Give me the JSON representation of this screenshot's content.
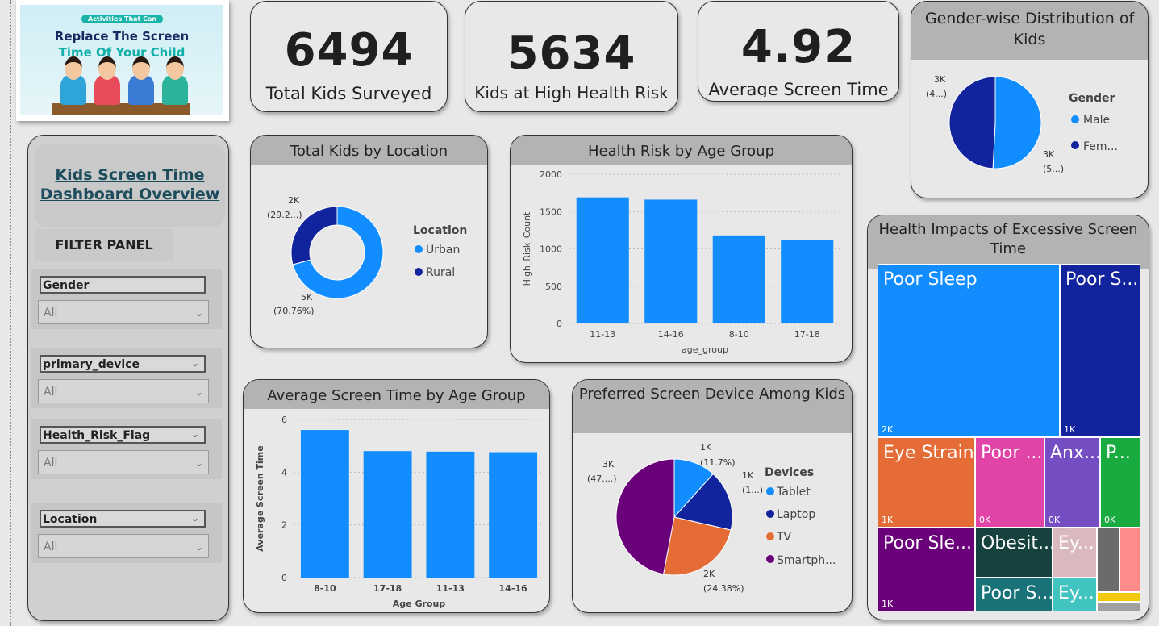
{
  "banner": {
    "tag": "Activities That Can",
    "line1": "Replace The Screen",
    "line2": "Time Of Your Child"
  },
  "kpis": [
    {
      "value": "6494",
      "label": "Total Kids Surveyed"
    },
    {
      "value": "5634",
      "label": "Kids at High Health Risk"
    },
    {
      "value": "4.92",
      "label": "Average Screen Time"
    }
  ],
  "sidebar": {
    "title_line1": "Kids Screen Time",
    "title_line2": "Dashboard Overview",
    "filter_panel": "FILTER PANEL",
    "slicers": [
      {
        "name": "Gender",
        "value": "All"
      },
      {
        "name": "primary_device",
        "value": "All"
      },
      {
        "name": "Health_Risk_Flag",
        "value": "All"
      },
      {
        "name": "Location",
        "value": "All"
      }
    ]
  },
  "colors": {
    "blue": "#118DFF",
    "navy": "#12239E",
    "orange": "#E66C37",
    "purple": "#6B007B",
    "pink": "#E044A7",
    "violet": "#744EC2",
    "green": "#1AAB40",
    "teal": "#15413E",
    "steel": "#197278"
  },
  "chart_data": [
    {
      "type": "pie",
      "title": "Gender-wise Distribution of Kids",
      "legend_title": "Gender",
      "legend_position": "right",
      "categories": [
        "Male",
        "Female"
      ],
      "legend_labels": [
        "Male",
        "Fem..."
      ],
      "data_labels": [
        [
          "3K",
          "(5...)"
        ],
        [
          "3K",
          "(4...)"
        ]
      ],
      "values": [
        3300,
        3194
      ]
    },
    {
      "type": "pie",
      "subtype": "donut",
      "title": "Total Kids by Location",
      "legend_title": "Location",
      "legend_position": "right",
      "categories": [
        "Urban",
        "Rural"
      ],
      "legend_labels": [
        "Urban",
        "Rural"
      ],
      "values": [
        70.76,
        29.24
      ],
      "data_labels": [
        [
          "5K",
          "(70.76%)"
        ],
        [
          "2K",
          "(29.2...)"
        ]
      ]
    },
    {
      "type": "bar",
      "title": "Health Risk by Age Group",
      "categories": [
        "11-13",
        "14-16",
        "8-10",
        "17-18"
      ],
      "values": [
        1690,
        1660,
        1180,
        1120
      ],
      "xlabel": "age_group",
      "ylabel": "High_Risk_Count",
      "ylim": [
        0,
        2000
      ],
      "yticks": [
        "0",
        "500",
        "1000",
        "1500",
        "2000"
      ],
      "grid": true
    },
    {
      "type": "bar",
      "title": "Average Screen Time by Age Group",
      "categories": [
        "8-10",
        "17-18",
        "11-13",
        "14-16"
      ],
      "values": [
        5.6,
        4.8,
        4.78,
        4.76
      ],
      "xlabel": "Age Group",
      "ylabel": "Average Screen Time",
      "ylim": [
        0,
        6
      ],
      "yticks": [
        "0",
        "2",
        "4",
        "6"
      ],
      "grid": true
    },
    {
      "type": "pie",
      "title": "Preferred Screen Device Among Kids",
      "legend_title": "Devices",
      "legend_position": "right",
      "categories": [
        "Tablet",
        "Laptop",
        "TV",
        "Smartphone"
      ],
      "legend_labels": [
        "Tablet",
        "Laptop",
        "TV",
        "Smartph..."
      ],
      "values": [
        11.7,
        16.9,
        24.38,
        47.02
      ],
      "data_labels": [
        [
          "1K",
          "(11.7%)"
        ],
        [
          "1K",
          "(1...)"
        ],
        [
          "2K",
          "(24.38%)"
        ],
        [
          "3K",
          "(47....)"
        ]
      ]
    },
    {
      "type": "treemap",
      "title": "Health Impacts of Excessive Screen Time",
      "items": [
        {
          "label": "Poor Sleep",
          "value": "2K"
        },
        {
          "label": "Poor S...",
          "value": "1K"
        },
        {
          "label": "Eye Strain",
          "value": "1K"
        },
        {
          "label": "Poor ...",
          "value": "0K"
        },
        {
          "label": "Anx...",
          "value": "0K"
        },
        {
          "label": "P...",
          "value": "0K"
        },
        {
          "label": "Poor Sle...",
          "value": "1K"
        },
        {
          "label": "Obesit...",
          "value": ""
        },
        {
          "label": "Ey...",
          "value": ""
        },
        {
          "label": "Poor S...",
          "value": ""
        },
        {
          "label": "Ey...",
          "value": ""
        },
        {
          "label": "",
          "value": ""
        },
        {
          "label": "",
          "value": ""
        },
        {
          "label": "",
          "value": ""
        },
        {
          "label": "",
          "value": ""
        }
      ]
    }
  ]
}
